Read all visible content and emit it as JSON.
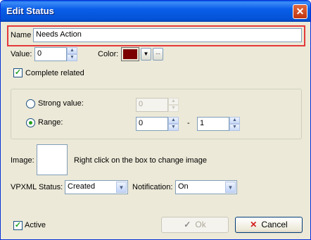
{
  "window": {
    "title": "Edit Status",
    "close_glyph": "✕"
  },
  "name": {
    "label": "Name",
    "value": "Needs Action"
  },
  "value": {
    "label": "Value:",
    "value": "0"
  },
  "color": {
    "label": "Color:",
    "swatch": "#7d0000",
    "more_glyph": "..."
  },
  "complete_related": {
    "label": "Complete related",
    "checked": true
  },
  "strong_value": {
    "label": "Strong value:",
    "value": "0",
    "selected": false
  },
  "range": {
    "label": "Range:",
    "from": "0",
    "separator": "-",
    "to": "1",
    "selected": true
  },
  "image": {
    "label": "Image:",
    "hint": "Right click on the box to  change image"
  },
  "vpxml_status": {
    "label": "VPXML Status:",
    "value": "Created"
  },
  "notification": {
    "label": "Notification:",
    "value": "On"
  },
  "active": {
    "label": "Active",
    "checked": true
  },
  "buttons": {
    "ok": "Ok",
    "cancel": "Cancel"
  },
  "glyphs": {
    "check": "✓",
    "up": "▲",
    "down": "▼",
    "cross": "✕"
  },
  "colors": {
    "accent": "#e4393a",
    "title_bar": "#0a5ee8",
    "ok_icon": "#8a8a8a",
    "cancel_icon": "#d11a1a"
  }
}
